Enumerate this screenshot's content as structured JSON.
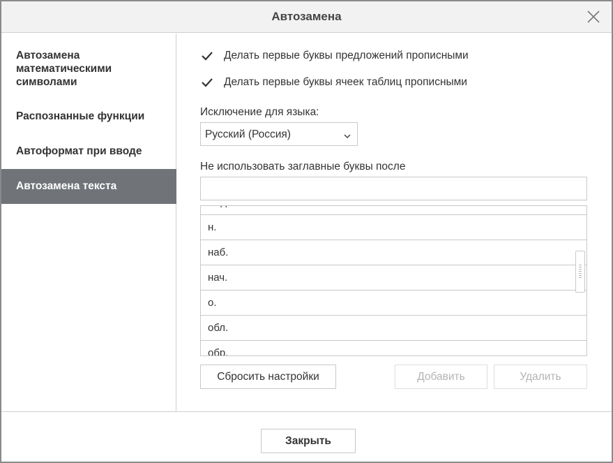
{
  "dialog": {
    "title": "Автозамена",
    "close_icon": "close-x-icon"
  },
  "sidebar": {
    "items": [
      {
        "label": "Автозамена математическими символами",
        "lines": [
          "Автозамена",
          "математическими",
          "символами"
        ]
      },
      {
        "label": "Распознанные функции"
      },
      {
        "label": "Автоформат при вводе"
      },
      {
        "label": "Автозамена текста",
        "active": true
      }
    ]
  },
  "options": {
    "capitalize_sentences": {
      "label": "Делать первые буквы предложений прописными",
      "checked": true
    },
    "capitalize_table_cells": {
      "label": "Делать первые буквы ячеек таблиц прописными",
      "checked": true
    }
  },
  "exceptions": {
    "language_label": "Исключение для языка:",
    "language_value": "Русский (Россия)",
    "no_caps_label": "Не использовать заглавные буквы после",
    "input_value": "",
    "list_items": [
      "мед.",
      "н.",
      "наб.",
      "нач.",
      "о.",
      "обл.",
      "обр."
    ]
  },
  "buttons": {
    "reset": "Сбросить настройки",
    "add": "Добавить",
    "delete": "Удалить",
    "add_disabled": true,
    "delete_disabled": true
  },
  "footer": {
    "close": "Закрыть"
  }
}
